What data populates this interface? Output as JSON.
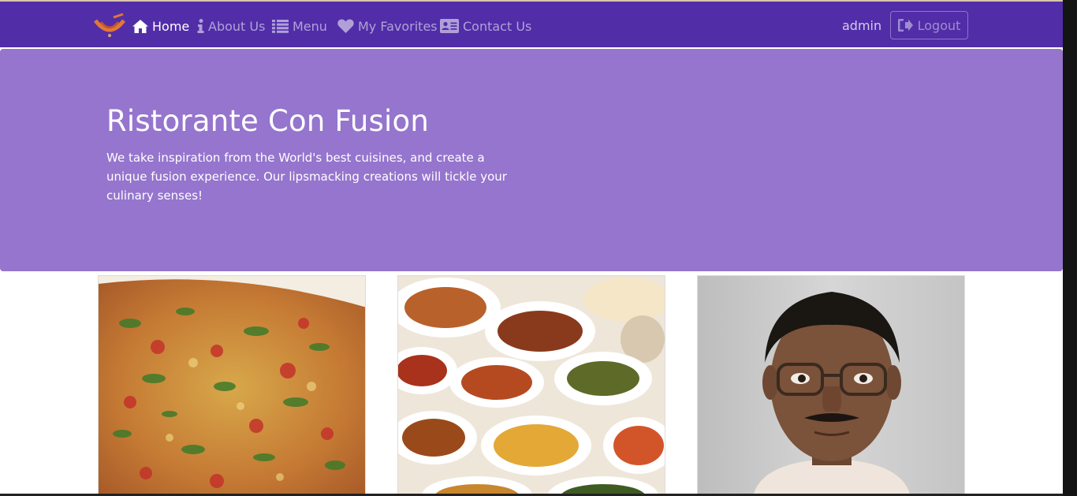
{
  "navbar": {
    "brand_logo": "restaurant-logo",
    "items": [
      {
        "label": "Home",
        "icon": "home-icon",
        "active": true
      },
      {
        "label": "About Us",
        "icon": "info-icon",
        "active": false
      },
      {
        "label": "Menu",
        "icon": "list-icon",
        "active": false
      },
      {
        "label": "My Favorites",
        "icon": "heart-icon",
        "active": false
      },
      {
        "label": "Contact Us",
        "icon": "address-card-icon",
        "active": false
      }
    ],
    "user": "admin",
    "logout_label": "Logout"
  },
  "hero": {
    "title": "Ristorante Con Fusion",
    "text": "We take inspiration from the World's best cuisines, and create a unique fusion experience. Our lipsmacking creations will tickle your culinary senses!"
  },
  "cards": [
    {
      "image": "pizza-image"
    },
    {
      "image": "buffet-image"
    },
    {
      "image": "chef-portrait-image"
    }
  ],
  "colors": {
    "navbar": "#512da8",
    "jumbotron": "#9575cd"
  }
}
